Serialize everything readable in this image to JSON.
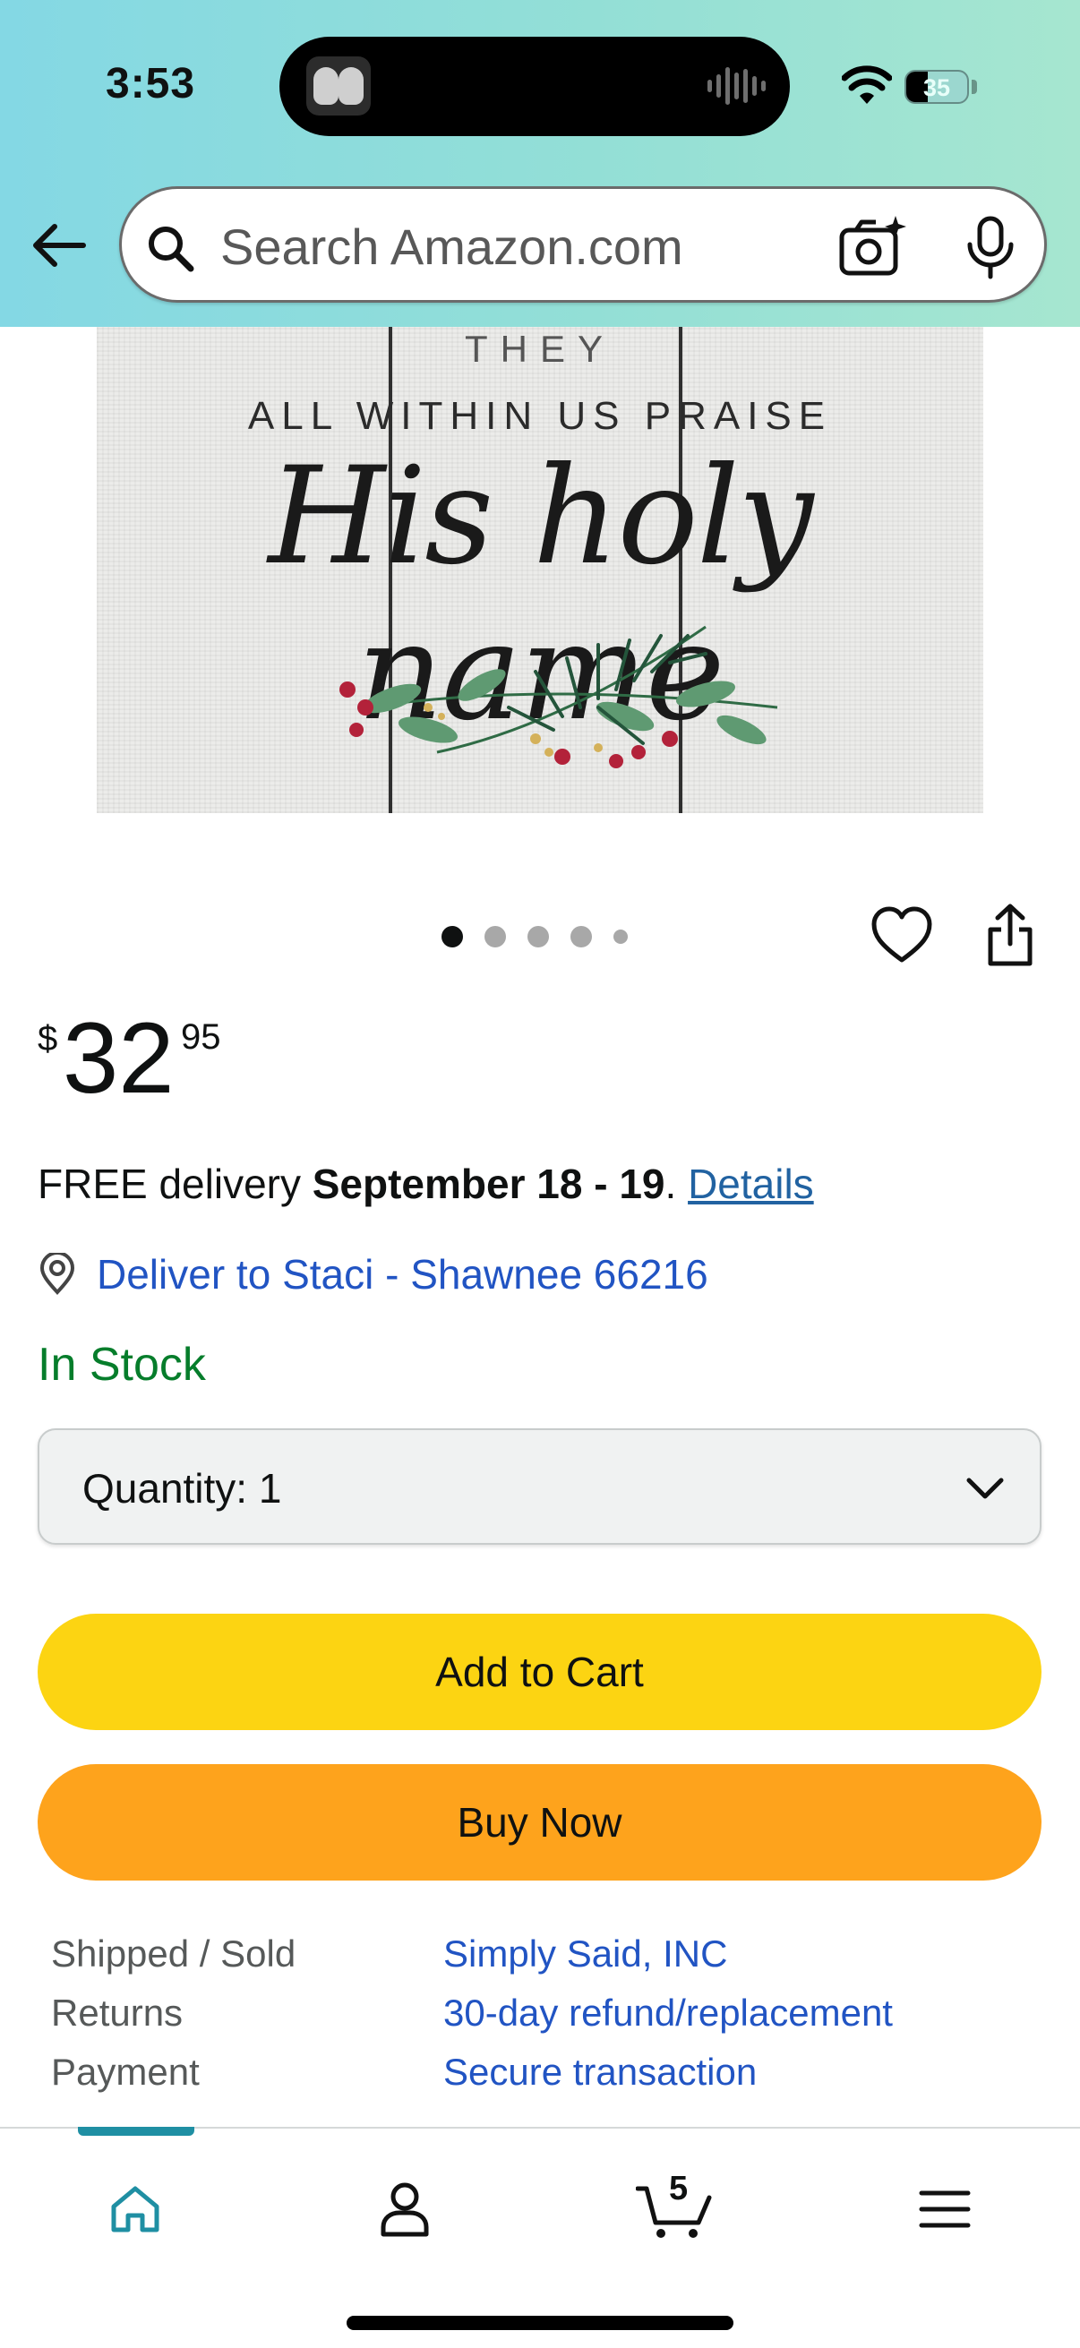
{
  "status_bar": {
    "time": "3:53",
    "battery_level": "35",
    "battery_fraction": 0.35
  },
  "header": {
    "search": {
      "placeholder": "Search Amazon.com",
      "value": ""
    }
  },
  "product_image": {
    "partial_text": "GRATEFUL CHORUS RAISE THEY",
    "subtitle_text": "ALL WITHIN US PRAISE",
    "script_text": "His holy name",
    "dots_total": 5,
    "dots_active_index": 0
  },
  "price": {
    "currency": "$",
    "whole": "32",
    "fraction": "95"
  },
  "delivery": {
    "prefix": "FREE delivery ",
    "dates": "September 18 - 19",
    "separator": ". ",
    "details_link": "Details"
  },
  "deliver_to": {
    "label": "Deliver to Staci - Shawnee 66216"
  },
  "stock_status": "In Stock",
  "quantity": {
    "label": "Quantity:",
    "value": "1"
  },
  "buttons": {
    "add_to_cart": "Add to Cart",
    "buy_now": "Buy Now"
  },
  "info": [
    {
      "key": "Shipped / Sold",
      "value": "Simply Said, INC"
    },
    {
      "key": "Returns",
      "value": "30-day refund/replacement"
    },
    {
      "key": "Payment",
      "value": "Secure transaction"
    }
  ],
  "bottom_nav": {
    "cart_count": "5",
    "active": "home"
  },
  "colors": {
    "header_gradient_start": "#84d8e4",
    "header_gradient_end": "#a6e6d0",
    "link": "#2154c3",
    "in_stock": "#067d2b",
    "add_to_cart": "#fcd412",
    "buy_now": "#fea31c",
    "nav_active": "#1f8fa3"
  }
}
